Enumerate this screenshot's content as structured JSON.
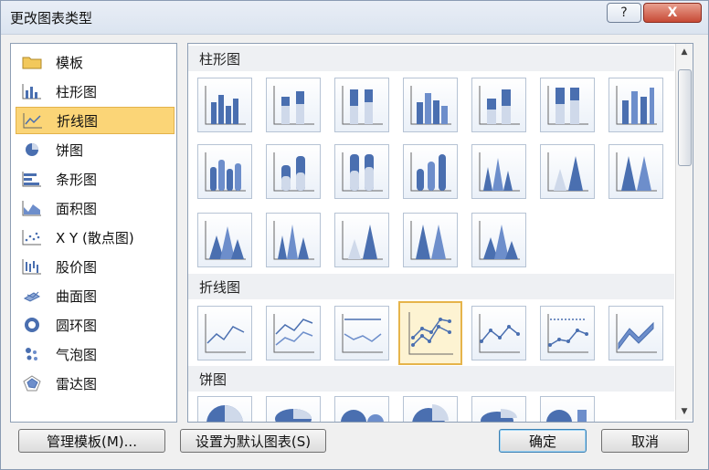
{
  "dialog": {
    "title": "更改图表类型",
    "help_label": "?",
    "close_label": "X"
  },
  "chart_types": [
    {
      "label": "模板",
      "icon": "folder-icon"
    },
    {
      "label": "柱形图",
      "icon": "column-chart-icon"
    },
    {
      "label": "折线图",
      "icon": "line-chart-icon",
      "selected": true
    },
    {
      "label": "饼图",
      "icon": "pie-chart-icon"
    },
    {
      "label": "条形图",
      "icon": "bar-chart-icon"
    },
    {
      "label": "面积图",
      "icon": "area-chart-icon"
    },
    {
      "label": "X Y (散点图)",
      "icon": "scatter-chart-icon"
    },
    {
      "label": "股价图",
      "icon": "stock-chart-icon"
    },
    {
      "label": "曲面图",
      "icon": "surface-chart-icon"
    },
    {
      "label": "圆环图",
      "icon": "doughnut-chart-icon"
    },
    {
      "label": "气泡图",
      "icon": "bubble-chart-icon"
    },
    {
      "label": "雷达图",
      "icon": "radar-chart-icon"
    }
  ],
  "sections": {
    "column": {
      "title": "柱形图"
    },
    "line": {
      "title": "折线图"
    },
    "pie": {
      "title": "饼图"
    }
  },
  "buttons": {
    "manage_templates": "管理模板(M)...",
    "set_default": "设置为默认图表(S)",
    "ok": "确定",
    "cancel": "取消"
  },
  "colors": {
    "selection": "#fbd577",
    "thumbnail_blue": "#4a6fb0"
  }
}
